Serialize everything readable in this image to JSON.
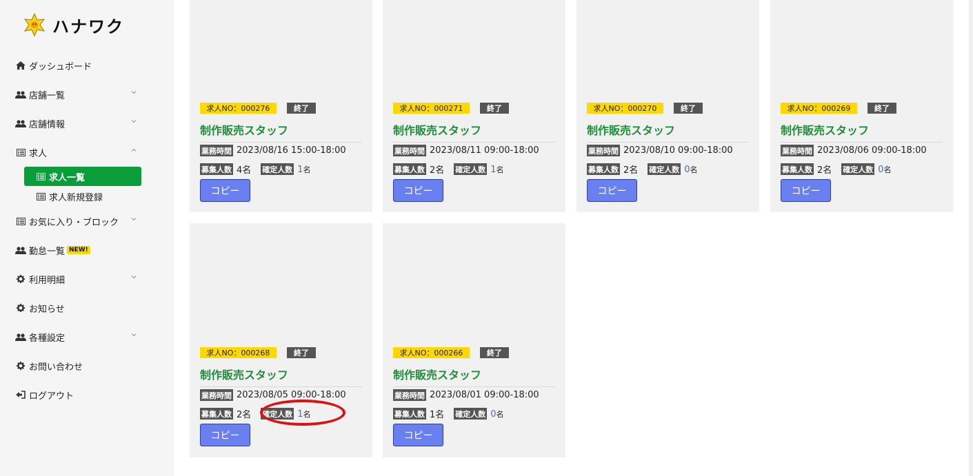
{
  "app": {
    "name": "ハナワク"
  },
  "sidebar": {
    "items": [
      {
        "label": "ダッシュボード",
        "icon": "home-icon"
      },
      {
        "label": "店舗一覧",
        "icon": "users-icon"
      },
      {
        "label": "店舗情報",
        "icon": "users-icon"
      },
      {
        "label": "求人",
        "icon": "list-icon"
      },
      {
        "label": "お気に入り・ブロック",
        "icon": "list-icon"
      },
      {
        "label": "勤怠一覧",
        "icon": "users-icon",
        "badge": "NEW!"
      },
      {
        "label": "利用明細",
        "icon": "gear-icon"
      },
      {
        "label": "お知らせ",
        "icon": "gear-icon"
      },
      {
        "label": "各種設定",
        "icon": "users-icon"
      },
      {
        "label": "お問い合わせ",
        "icon": "gear-icon"
      },
      {
        "label": "ログアウト",
        "icon": "logout-icon"
      }
    ],
    "sub_items": [
      {
        "label": "求人一覧",
        "active": true
      },
      {
        "label": "求人新規登録",
        "active": false
      }
    ]
  },
  "labels": {
    "job_no_prefix": "求人NO：",
    "status_end": "終了",
    "work_time": "業務時間",
    "recruit_count": "募集人数",
    "confirmed_count": "確定人数",
    "copy": "コピー",
    "unit": "名"
  },
  "jobs": [
    {
      "no": "求人NO：000276",
      "status": "終了",
      "title": "制作販売スタッフ",
      "time": "2023/08/16 15:00-18:00",
      "recruit": "4名",
      "confirmed": "1",
      "unit": "名",
      "copy": "コピー"
    },
    {
      "no": "求人NO：000271",
      "status": "終了",
      "title": "制作販売スタッフ",
      "time": "2023/08/11 09:00-18:00",
      "recruit": "2名",
      "confirmed": "1",
      "unit": "名",
      "copy": "コピー"
    },
    {
      "no": "求人NO：000270",
      "status": "終了",
      "title": "制作販売スタッフ",
      "time": "2023/08/10 09:00-18:00",
      "recruit": "2名",
      "confirmed": "0",
      "unit": "名",
      "copy": "コピー"
    },
    {
      "no": "求人NO：000269",
      "status": "終了",
      "title": "制作販売スタッフ",
      "time": "2023/08/06 09:00-18:00",
      "recruit": "2名",
      "confirmed": "0",
      "unit": "名",
      "copy": "コピー"
    },
    {
      "no": "求人NO：000268",
      "status": "終了",
      "title": "制作販売スタッフ",
      "time": "2023/08/05 09:00-18:00",
      "recruit": "2名",
      "confirmed": "1",
      "unit": "名",
      "copy": "コピー"
    },
    {
      "no": "求人NO：000266",
      "status": "終了",
      "title": "制作販売スタッフ",
      "time": "2023/08/01 09:00-18:00",
      "recruit": "1名",
      "confirmed": "0",
      "unit": "名",
      "copy": "コピー"
    }
  ],
  "colors": {
    "accent_green": "#0a9d3a",
    "title_green": "#1f8e3a",
    "badge_yellow": "#ffd800",
    "button_blue": "#6a7ff0",
    "annotation_red": "#e01010"
  }
}
